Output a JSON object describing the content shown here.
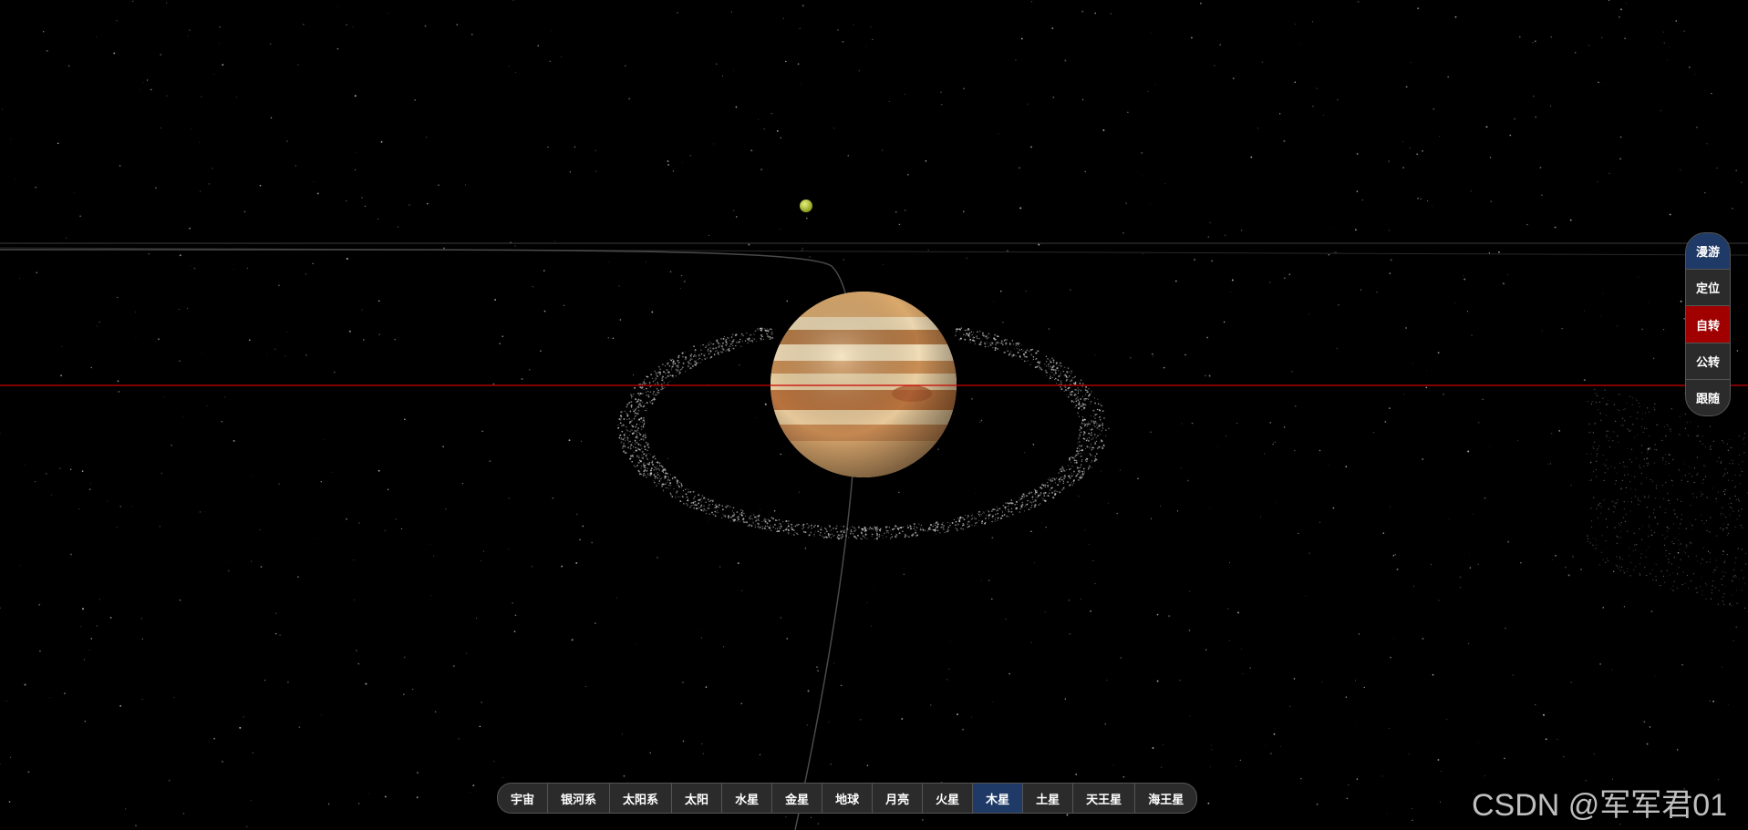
{
  "side_toolbar": {
    "items": [
      {
        "label": "漫游",
        "state": "active-blue"
      },
      {
        "label": "定位",
        "state": ""
      },
      {
        "label": "自转",
        "state": "active-red"
      },
      {
        "label": "公转",
        "state": ""
      },
      {
        "label": "跟随",
        "state": ""
      }
    ]
  },
  "bottom_nav": {
    "items": [
      {
        "label": "宇宙"
      },
      {
        "label": "银河系"
      },
      {
        "label": "太阳系"
      },
      {
        "label": "太阳"
      },
      {
        "label": "水星"
      },
      {
        "label": "金星"
      },
      {
        "label": "地球"
      },
      {
        "label": "月亮"
      },
      {
        "label": "火星"
      },
      {
        "label": "木星",
        "active": true
      },
      {
        "label": "土星"
      },
      {
        "label": "天王星"
      },
      {
        "label": "海王星"
      }
    ]
  },
  "watermark": "CSDN @军军君01",
  "colors": {
    "background": "#000000",
    "active_blue": "#1f3a66",
    "active_red": "#a00000",
    "toolbar_bg": "#2b2b2b",
    "axis_line": "#cc0000",
    "moon": "#c4d23a"
  }
}
